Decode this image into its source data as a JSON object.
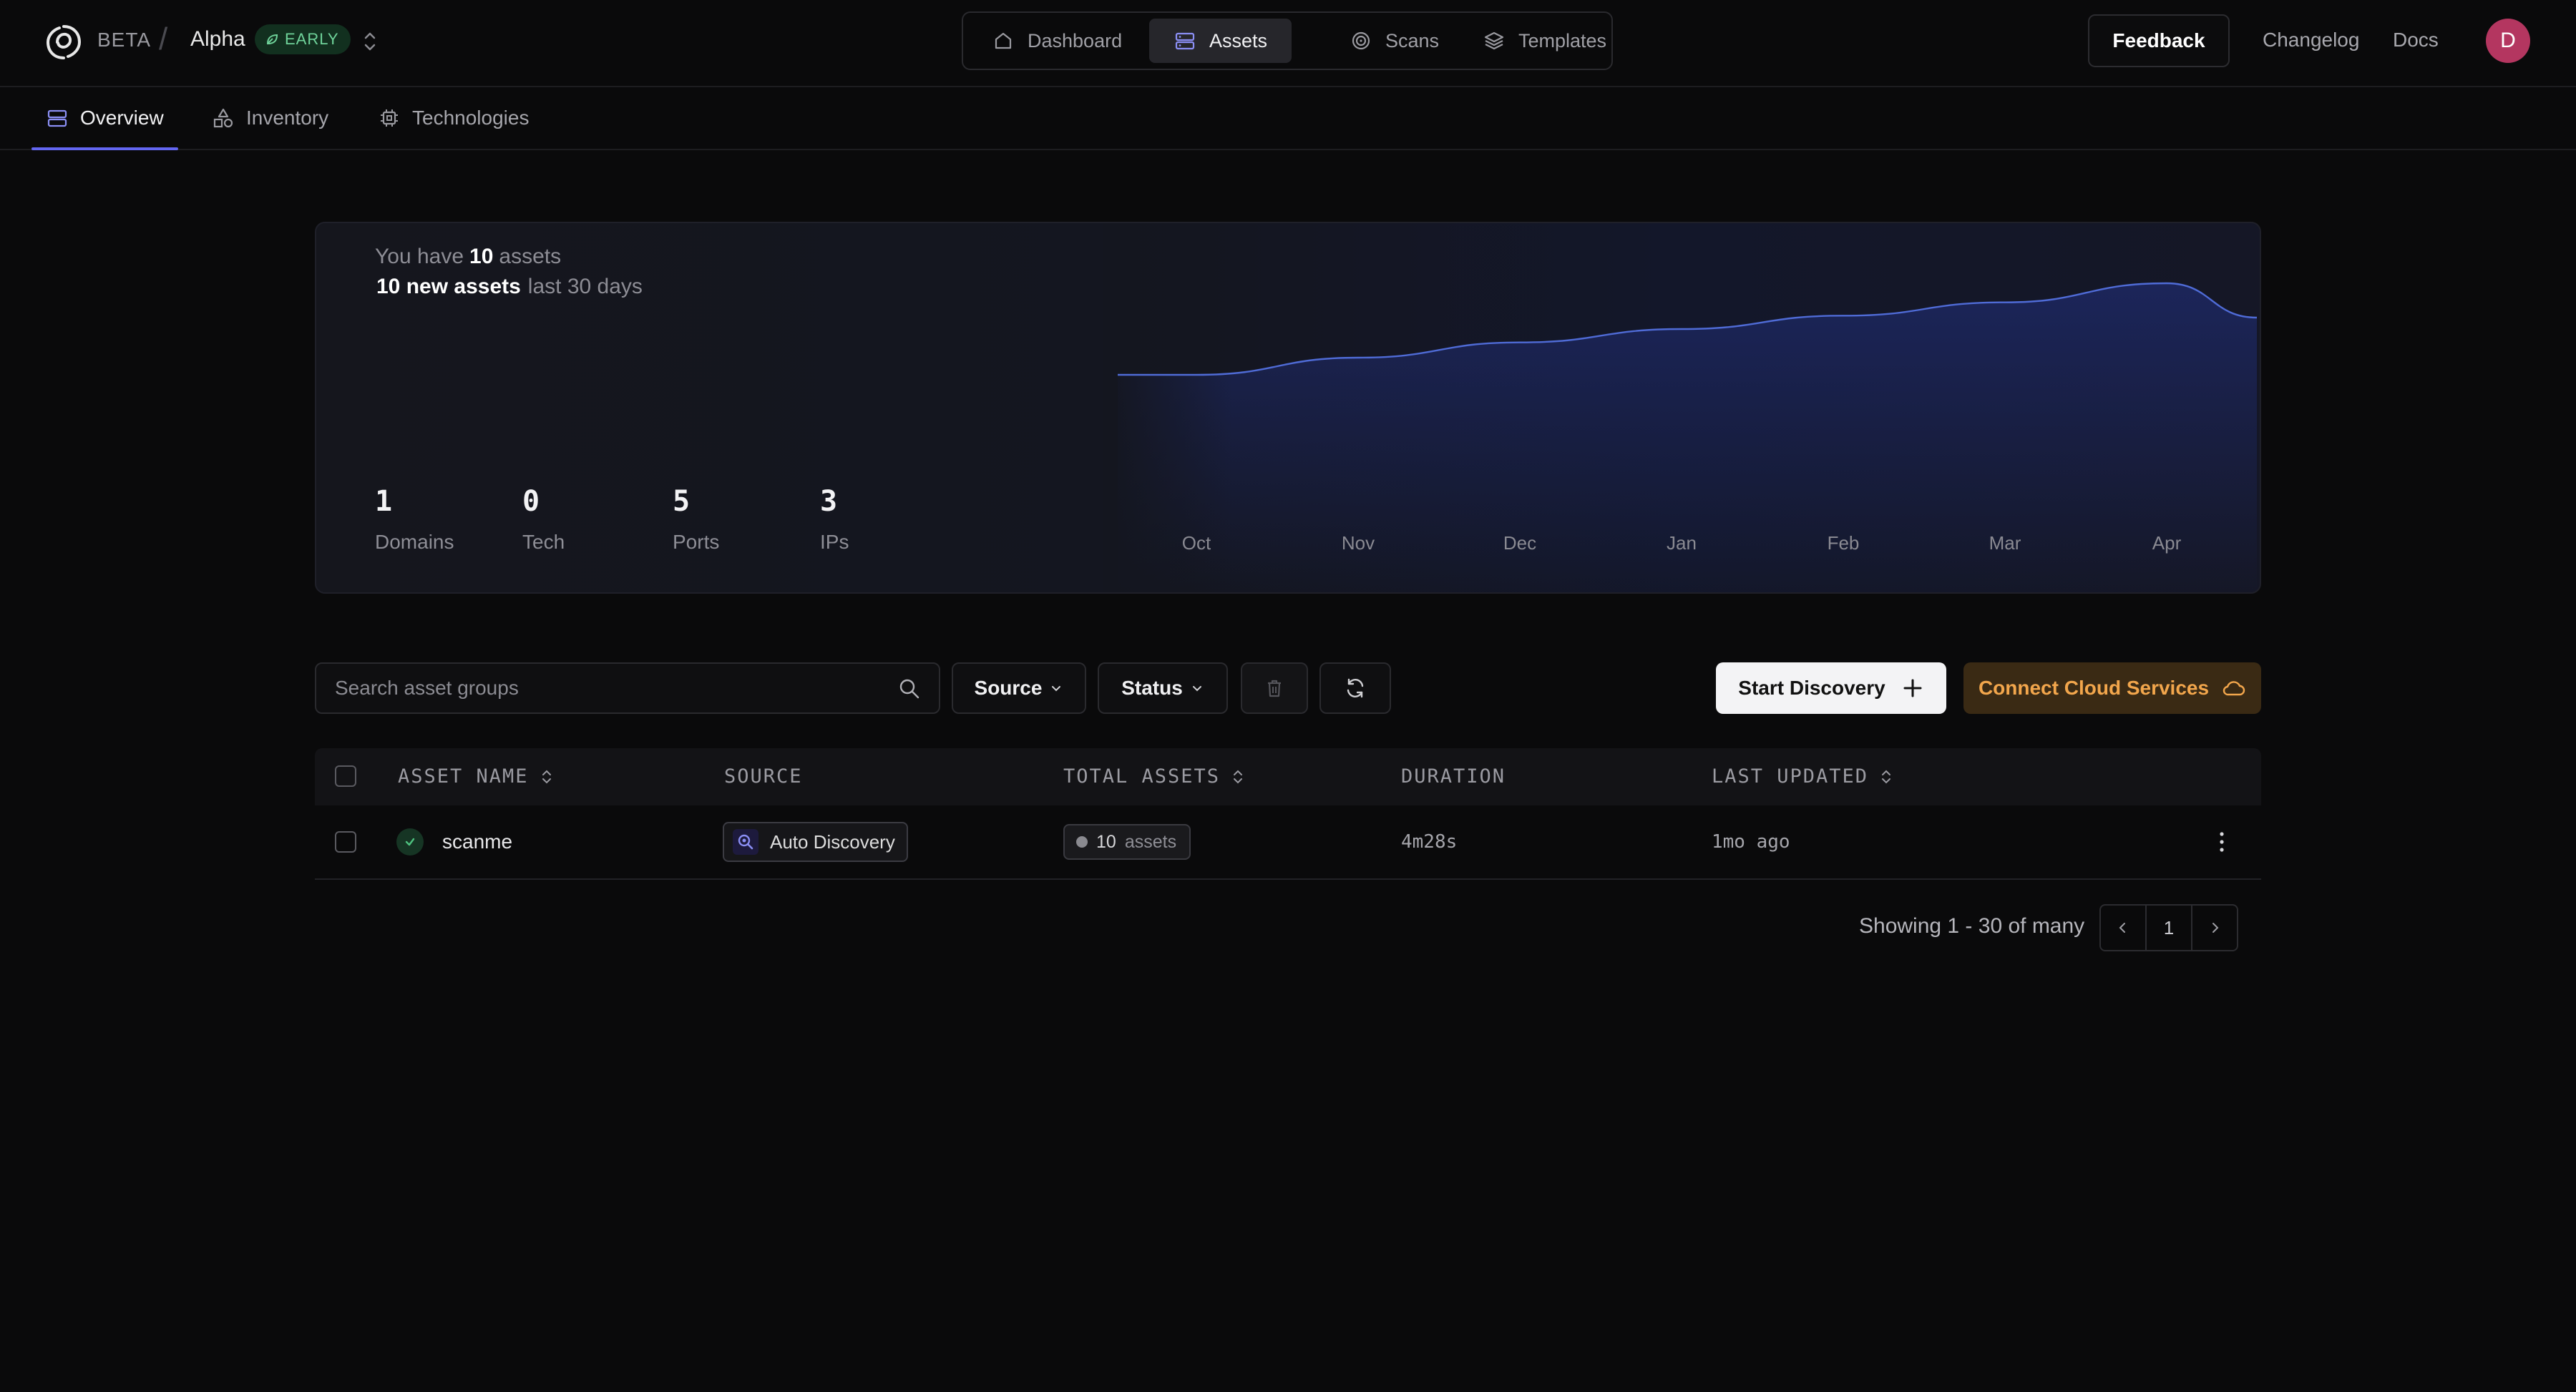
{
  "header": {
    "beta": "BETA",
    "workspace": "Alpha",
    "workspace_badge": "EARLY",
    "nav": [
      "Dashboard",
      "Assets",
      "Scans",
      "Templates"
    ],
    "active_nav": "Assets",
    "feedback": "Feedback",
    "changelog": "Changelog",
    "docs": "Docs",
    "avatar_initial": "D"
  },
  "subtabs": [
    "Overview",
    "Inventory",
    "Technologies"
  ],
  "summary": {
    "you_have": "You have",
    "asset_count": "10",
    "assets_word": "assets",
    "new_assets": "10 new assets",
    "period": "last 30 days",
    "stats": [
      {
        "value": "1",
        "label": "Domains"
      },
      {
        "value": "0",
        "label": "Tech"
      },
      {
        "value": "5",
        "label": "Ports"
      },
      {
        "value": "3",
        "label": "IPs"
      }
    ]
  },
  "chart_data": {
    "type": "area",
    "categories": [
      "Oct",
      "Nov",
      "Dec",
      "Jan",
      "Feb",
      "Mar",
      "Apr"
    ],
    "values": [
      0.0,
      1.8,
      3.4,
      4.8,
      6.2,
      7.6,
      9.6
    ],
    "title": "",
    "xlabel": "",
    "ylabel": "",
    "grid": false,
    "line_color": "#4f6bd6",
    "fill_color": "#1e2a6b"
  },
  "toolbar": {
    "search_placeholder": "Search asset groups",
    "source": "Source",
    "status": "Status",
    "start_discovery": "Start Discovery",
    "connect_cloud": "Connect Cloud Services"
  },
  "table": {
    "headers": [
      "ASSET NAME",
      "SOURCE",
      "TOTAL ASSETS",
      "DURATION",
      "LAST UPDATED"
    ],
    "rows": [
      {
        "name": "scanme",
        "source": "Auto Discovery",
        "total_count": "10",
        "total_word": "assets",
        "duration": "4m28s",
        "updated": "1mo ago"
      }
    ]
  },
  "pagination": {
    "showing": "Showing 1 - 30 of many",
    "page": "1"
  },
  "colors": {
    "accent": "#6366f1",
    "success": "#6fd39a",
    "cloud": "#f2a64c",
    "avatar": "#b43660"
  }
}
